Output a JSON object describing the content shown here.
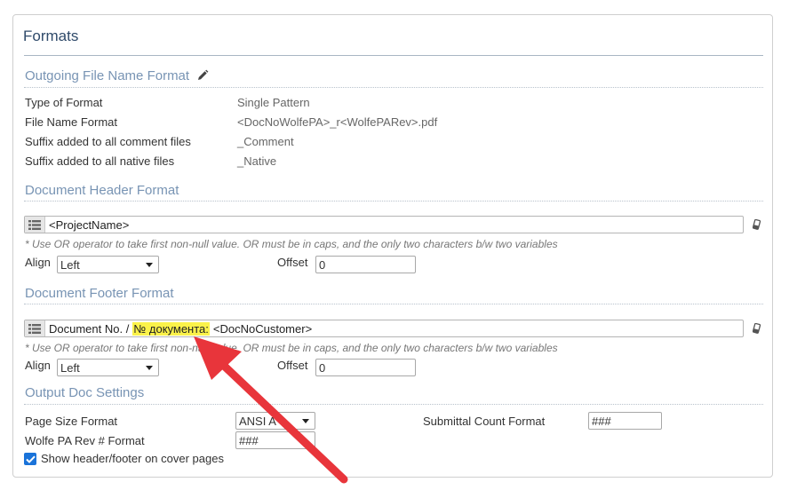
{
  "panel": {
    "title": "Formats"
  },
  "outgoing": {
    "title": "Outgoing File Name Format",
    "edit_icon": "pencil-icon",
    "rows": [
      {
        "label": "Type of Format",
        "value": "Single Pattern"
      },
      {
        "label": "File Name Format",
        "value": "<DocNoWolfePA>_r<WolfePARev>.pdf"
      },
      {
        "label": "Suffix added to all comment files",
        "value": "_Comment"
      },
      {
        "label": "Suffix added to all native files",
        "value": "_Native"
      }
    ]
  },
  "header_format": {
    "title": "Document Header Format",
    "value": "<ProjectName>",
    "hint": "* Use OR operator to take first non-null value. OR must be in caps, and the only two characters b/w two variables",
    "align_label": "Align",
    "align_value": "Left",
    "offset_label": "Offset",
    "offset_value": "0"
  },
  "footer_format": {
    "title": "Document Footer Format",
    "value_prefix": "Document No. /",
    "value_highlight": "№ документа:",
    "value_suffix": "<DocNoCustomer>",
    "hint": "* Use OR operator to take first non-null value. OR must be in caps, and the only two characters b/w two variables",
    "align_label": "Align",
    "align_value": "Left",
    "offset_label": "Offset",
    "offset_value": "0"
  },
  "output_doc": {
    "title": "Output Doc Settings",
    "page_size_label": "Page Size Format",
    "page_size_value": "ANSI A",
    "rev_format_label": "Wolfe PA Rev # Format",
    "rev_format_value": "###",
    "submittal_count_label": "Submittal Count Format",
    "submittal_count_value": "###",
    "cover_checkbox_label": "Show header/footer on cover pages",
    "cover_checkbox_checked": true
  },
  "colors": {
    "section_title": "#7894b4",
    "panel_title": "#2f4a6a",
    "highlight": "#fbf24a",
    "annotation_arrow": "#e8353b",
    "checkbox": "#1a73d9"
  }
}
